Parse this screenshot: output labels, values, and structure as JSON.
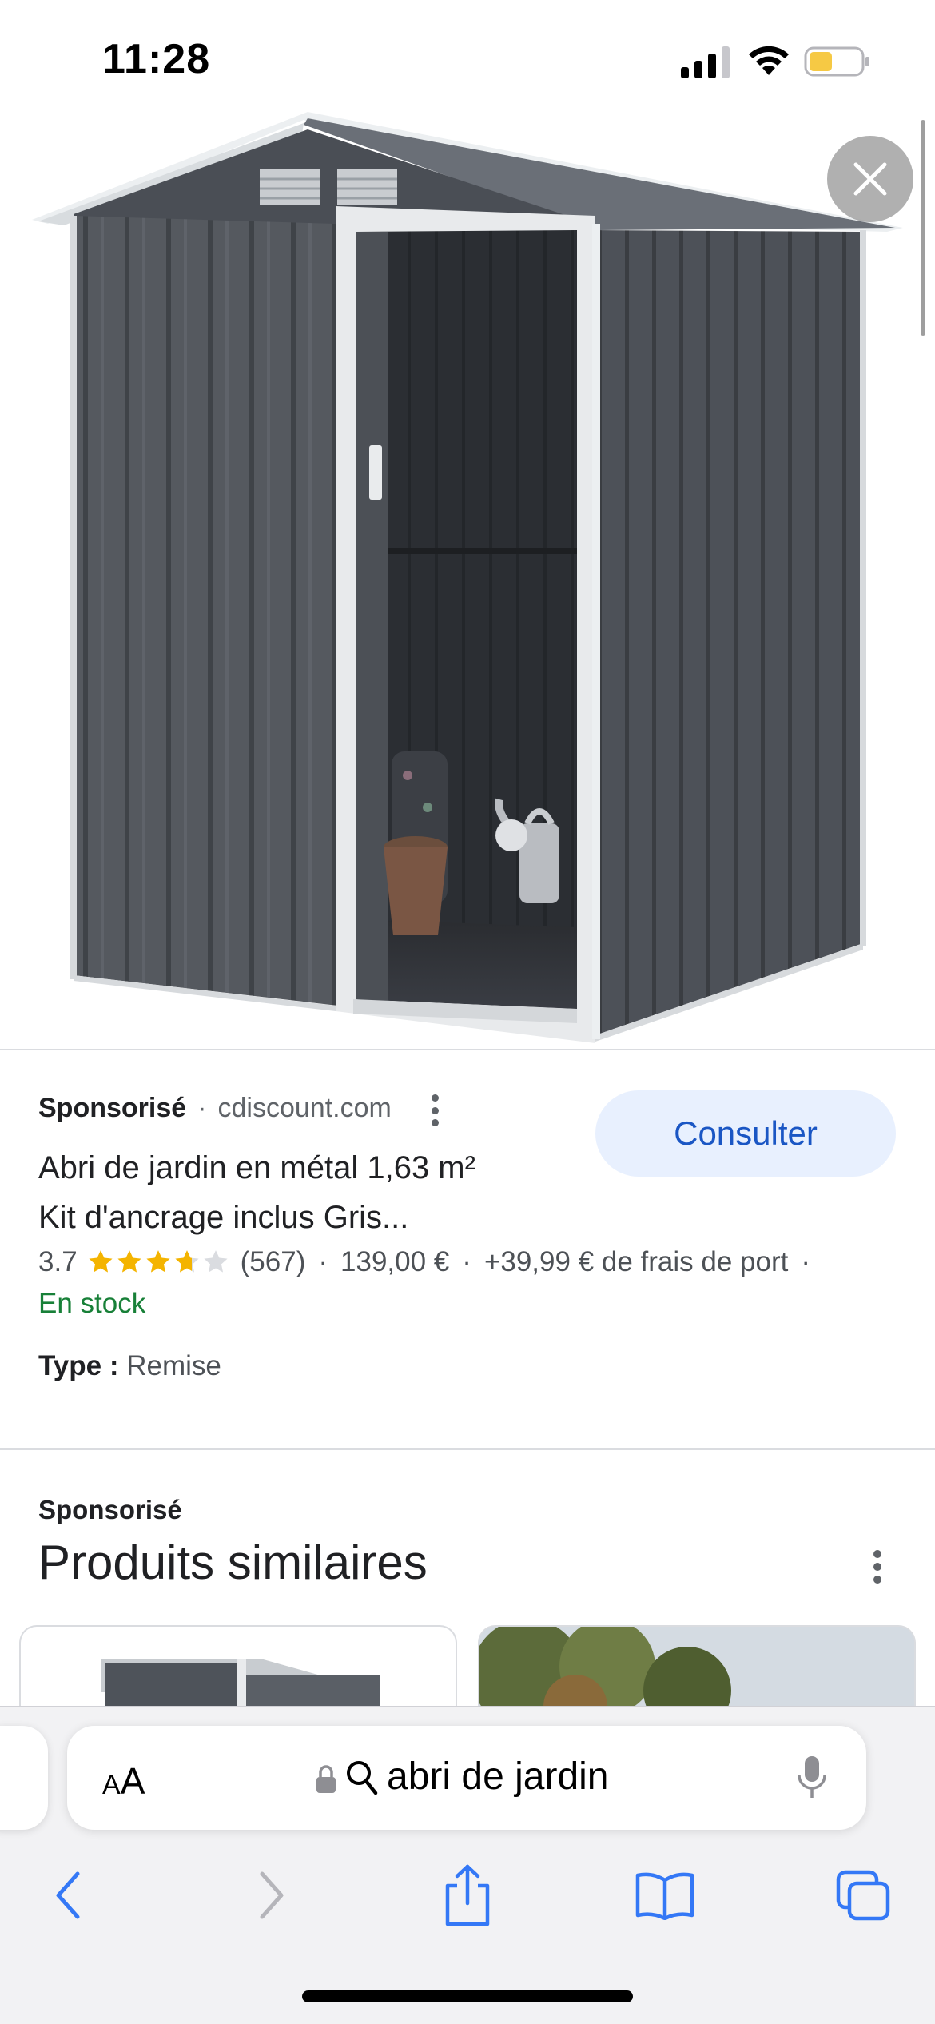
{
  "status_bar": {
    "time": "11:28"
  },
  "product": {
    "sponsored_label": "Sponsorisé",
    "domain": "cdiscount.com",
    "cta_label": "Consulter",
    "title_line1": "Abri de jardin en métal 1,63 m²",
    "title_line2": "Kit d'ancrage inclus Gris...",
    "rating": "3.7",
    "rating_value": 3.7,
    "rating_max": 5,
    "review_count": "(567)",
    "price": "139,00 €",
    "shipping": "+39,99 € de frais de port",
    "trailing_dot": "·",
    "stock": "En stock",
    "type_label": "Type :",
    "type_value": "Remise"
  },
  "similar": {
    "sponsored_label": "Sponsorisé",
    "title": "Produits similaires"
  },
  "browser": {
    "text_size_label_small": "A",
    "text_size_label_large": "A",
    "address_text": "abri de jardin"
  },
  "icons": {
    "close": "close-icon",
    "lock": "lock-icon",
    "search": "search-icon",
    "mic": "mic-icon",
    "back": "chevron-left-icon",
    "forward": "chevron-right-icon",
    "share": "share-icon",
    "bookmarks": "book-icon",
    "tabs": "tabs-icon"
  },
  "colors": {
    "accent_blue": "#1a56c4",
    "button_bg": "#e8f0fe",
    "stock_green": "#188038",
    "star": "#f4b400",
    "ios_blue": "#3478f6"
  }
}
